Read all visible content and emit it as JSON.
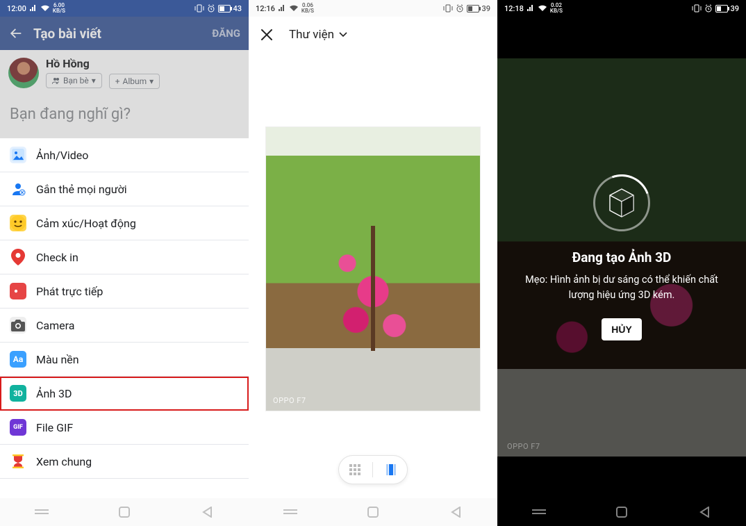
{
  "panel1": {
    "status": {
      "time": "12:00",
      "speed_top": "6.00",
      "speed_bot": "KB/S",
      "battery": "43"
    },
    "header": {
      "title": "Tạo bài viết",
      "post": "ĐĂNG"
    },
    "user": {
      "name": "Hồ Hồng",
      "audience": "Bạn bè",
      "album": "Album"
    },
    "prompt": "Bạn đang nghĩ gì?",
    "options": [
      {
        "label": "Ảnh/Video",
        "icon": "photo-video-icon",
        "cls": "ico-img"
      },
      {
        "label": "Gắn thẻ mọi người",
        "icon": "tag-people-icon",
        "cls": "ico-tag"
      },
      {
        "label": "Cảm xúc/Hoạt động",
        "icon": "feeling-icon",
        "cls": "ico-feel"
      },
      {
        "label": "Check in",
        "icon": "checkin-icon",
        "cls": "ico-chk"
      },
      {
        "label": "Phát trực tiếp",
        "icon": "live-icon",
        "cls": "ico-live"
      },
      {
        "label": "Camera",
        "icon": "camera-icon",
        "cls": "ico-cam"
      },
      {
        "label": "Màu nền",
        "icon": "background-icon",
        "cls": "ico-bg"
      },
      {
        "label": "Ảnh 3D",
        "icon": "photo-3d-icon",
        "cls": "ico-3d",
        "highlight": true
      },
      {
        "label": "File GIF",
        "icon": "gif-icon",
        "cls": "ico-gif"
      },
      {
        "label": "Xem chung",
        "icon": "watch-party-icon",
        "cls": "ico-watch"
      }
    ]
  },
  "panel2": {
    "status": {
      "time": "12:16",
      "speed_top": "0.06",
      "speed_bot": "KB/S",
      "battery": "39"
    },
    "header": {
      "title": "Thư viện"
    },
    "watermark": "OPPO F7"
  },
  "panel3": {
    "status": {
      "time": "12:18",
      "speed_top": "0.02",
      "speed_bot": "KB/S",
      "battery": "39"
    },
    "title": "Đang tạo Ảnh 3D",
    "tip": "Mẹo: Hình ảnh bị dư sáng có thể khiến chất lượng hiệu ứng 3D kém.",
    "cancel": "HỦY",
    "watermark": "OPPO F7"
  }
}
